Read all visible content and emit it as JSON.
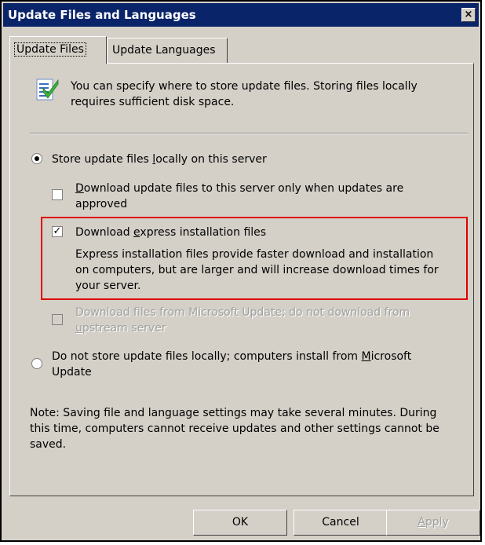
{
  "window": {
    "title": "Update Files and Languages",
    "close_glyph": "×"
  },
  "tabs": [
    {
      "label": "Update Files",
      "active": true
    },
    {
      "label": "Update Languages",
      "active": false
    }
  ],
  "info": {
    "icon": "document-checkmark-icon",
    "line1": "You can specify where to store update files. Storing files locally",
    "line2": "requires sufficient disk space."
  },
  "store_locally": {
    "pre": "Store update files ",
    "u": "l",
    "post": "ocally on this server",
    "selected": true
  },
  "approved_only": {
    "line1_u": "D",
    "line1_rest": "ownload update files to this server only when updates are",
    "line2": "approved",
    "checked": false
  },
  "express": {
    "pre": "Download ",
    "u": "e",
    "post": "xpress installation files",
    "checked": true,
    "desc1": "Express installation files provide faster download and installation",
    "desc2": "on computers, but are larger and will increase download times for",
    "desc3": "your server."
  },
  "microsoft_update": {
    "line1": "Download files from Microsoft Update; do not download from",
    "line2_u": "u",
    "line2_rest": "pstream server",
    "checked": false,
    "enabled": false
  },
  "not_local": {
    "line1_pre": "Do not store update files locally; computers install from ",
    "line1_u": "M",
    "line1_post": "icrosoft",
    "line2": "Update",
    "selected": false
  },
  "note": {
    "line1": "Note: Saving file and language settings may take several minutes. During",
    "line2": "this time, computers cannot receive updates and other settings cannot be",
    "line3": "saved."
  },
  "buttons": {
    "ok": "OK",
    "cancel": "Cancel",
    "apply_u": "A",
    "apply_rest": "pply"
  },
  "colors": {
    "title_bar": "#0a246a",
    "dialog_face": "#d4d0c8",
    "highlight_border": "#e00000"
  }
}
